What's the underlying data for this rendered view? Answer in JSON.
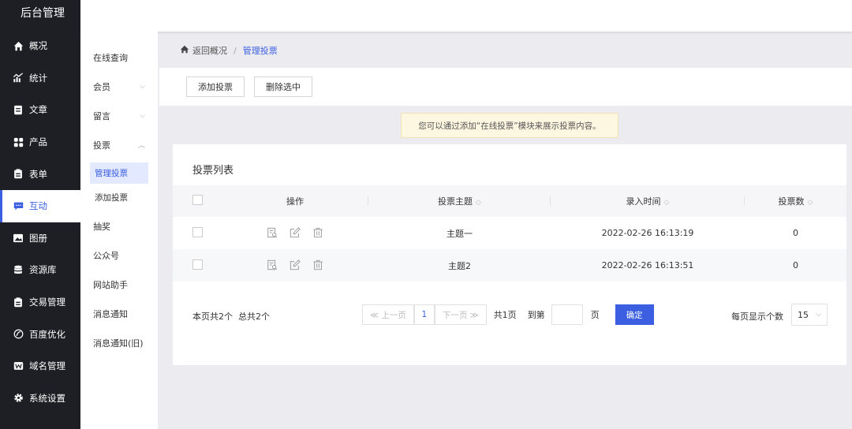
{
  "app": {
    "title": "后台管理"
  },
  "sidebar": {
    "items": [
      {
        "label": "概况",
        "icon": "home-icon"
      },
      {
        "label": "统计",
        "icon": "stats-icon"
      },
      {
        "label": "文章",
        "icon": "article-icon"
      },
      {
        "label": "产品",
        "icon": "product-icon"
      },
      {
        "label": "表单",
        "icon": "form-icon"
      },
      {
        "label": "互动",
        "icon": "chat-icon",
        "active": true
      },
      {
        "label": "图册",
        "icon": "gallery-icon"
      },
      {
        "label": "资源库",
        "icon": "database-icon"
      },
      {
        "label": "交易管理",
        "icon": "trade-icon"
      },
      {
        "label": "百度优化",
        "icon": "seo-icon"
      },
      {
        "label": "域名管理",
        "icon": "domain-icon"
      },
      {
        "label": "系统设置",
        "icon": "gear-icon"
      }
    ]
  },
  "subnav": {
    "online_query": "在线查询",
    "member": "会员",
    "message": "留言",
    "vote": "投票",
    "manage_vote": "管理投票",
    "add_vote": "添加投票",
    "lottery": "抽奖",
    "wechat": "公众号",
    "site_helper": "网站助手",
    "notification": "消息通知",
    "notification_old": "消息通知(旧)"
  },
  "breadcrumb": {
    "back": "返回概况",
    "separator": "/",
    "current": "管理投票"
  },
  "toolbar": {
    "add_label": "添加投票",
    "delete_label": "删除选中"
  },
  "tip": "您可以通过添加“在线投票”模块来展示投票内容。",
  "list": {
    "title": "投票列表",
    "headers": {
      "actions": "操作",
      "topic": "投票主题",
      "time": "录入时间",
      "count": "投票数"
    },
    "rows": [
      {
        "topic": "主题一",
        "time": "2022-02-26 16:13:19",
        "count": "0"
      },
      {
        "topic": "主题2",
        "time": "2022-02-26 16:13:51",
        "count": "0"
      }
    ]
  },
  "pagination": {
    "info": "本页共2个  总共2个",
    "prev": "≪ 上一页",
    "page": "1",
    "next": "下一页 ≫",
    "total_pages": "共1页",
    "goto": "到第",
    "page_unit": "页",
    "confirm": "确定",
    "page_size_label": "每页显示个数",
    "page_size": "15"
  },
  "colors": {
    "accent": "#3b5fe0",
    "sidebar_bg": "#1e1f24"
  }
}
